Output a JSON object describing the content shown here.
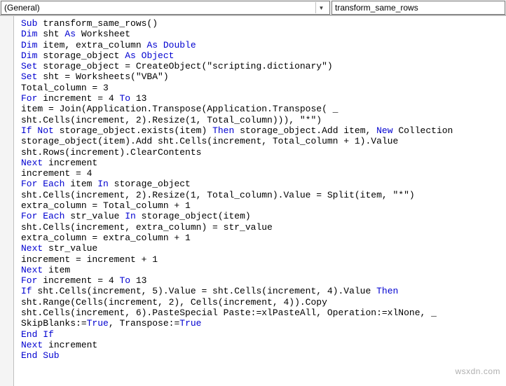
{
  "topbar": {
    "left_dropdown": "(General)",
    "right_dropdown": "transform_same_rows"
  },
  "code_tokens": [
    [
      [
        "kw",
        "Sub"
      ],
      [
        "",
        " transform_same_rows()"
      ]
    ],
    [
      [
        "kw",
        "Dim"
      ],
      [
        "",
        " sht "
      ],
      [
        "kw",
        "As"
      ],
      [
        "",
        " Worksheet"
      ]
    ],
    [
      [
        "kw",
        "Dim"
      ],
      [
        "",
        " item, extra_column "
      ],
      [
        "kw",
        "As Double"
      ]
    ],
    [
      [
        "kw",
        "Dim"
      ],
      [
        "",
        " storage_object "
      ],
      [
        "kw",
        "As Object"
      ]
    ],
    [
      [
        "kw",
        "Set"
      ],
      [
        "",
        " storage_object = CreateObject(\"scripting.dictionary\")"
      ]
    ],
    [
      [
        "kw",
        "Set"
      ],
      [
        "",
        " sht = Worksheets(\"VBA\")"
      ]
    ],
    [
      [
        "",
        "Total_column = 3"
      ]
    ],
    [
      [
        "kw",
        "For"
      ],
      [
        "",
        " increment = 4 "
      ],
      [
        "kw",
        "To"
      ],
      [
        "",
        " 13"
      ]
    ],
    [
      [
        "",
        "item = Join(Application.Transpose(Application.Transpose( _"
      ]
    ],
    [
      [
        "",
        "sht.Cells(increment, 2).Resize(1, Total_column))), \"*\")"
      ]
    ],
    [
      [
        "kw",
        "If Not"
      ],
      [
        "",
        " storage_object.exists(item) "
      ],
      [
        "kw",
        "Then"
      ],
      [
        "",
        " storage_object.Add item, "
      ],
      [
        "kw",
        "New"
      ],
      [
        "",
        " Collection"
      ]
    ],
    [
      [
        "",
        "storage_object(item).Add sht.Cells(increment, Total_column + 1).Value"
      ]
    ],
    [
      [
        "",
        "sht.Rows(increment).ClearContents"
      ]
    ],
    [
      [
        "kw",
        "Next"
      ],
      [
        "",
        " increment"
      ]
    ],
    [
      [
        "",
        "increment = 4"
      ]
    ],
    [
      [
        "kw",
        "For Each"
      ],
      [
        "",
        " item "
      ],
      [
        "kw",
        "In"
      ],
      [
        "",
        " storage_object"
      ]
    ],
    [
      [
        "",
        "sht.Cells(increment, 2).Resize(1, Total_column).Value = Split(item, \"*\")"
      ]
    ],
    [
      [
        "",
        "extra_column = Total_column + 1"
      ]
    ],
    [
      [
        "kw",
        "For Each"
      ],
      [
        "",
        " str_value "
      ],
      [
        "kw",
        "In"
      ],
      [
        "",
        " storage_object(item)"
      ]
    ],
    [
      [
        "",
        "sht.Cells(increment, extra_column) = str_value"
      ]
    ],
    [
      [
        "",
        "extra_column = extra_column + 1"
      ]
    ],
    [
      [
        "kw",
        "Next"
      ],
      [
        "",
        " str_value"
      ]
    ],
    [
      [
        "",
        "increment = increment + 1"
      ]
    ],
    [
      [
        "kw",
        "Next"
      ],
      [
        "",
        " item"
      ]
    ],
    [
      [
        "kw",
        "For"
      ],
      [
        "",
        " increment = 4 "
      ],
      [
        "kw",
        "To"
      ],
      [
        "",
        " 13"
      ]
    ],
    [
      [
        "kw",
        "If"
      ],
      [
        "",
        " sht.Cells(increment, 5).Value = sht.Cells(increment, 4).Value "
      ],
      [
        "kw",
        "Then"
      ]
    ],
    [
      [
        "",
        "sht.Range(Cells(increment, 2), Cells(increment, 4)).Copy"
      ]
    ],
    [
      [
        "",
        "sht.Cells(increment, 6).PasteSpecial Paste:=xlPasteAll, Operation:=xlNone, _"
      ]
    ],
    [
      [
        "",
        "SkipBlanks:="
      ],
      [
        "kw",
        "True"
      ],
      [
        "",
        ", Transpose:="
      ],
      [
        "kw",
        "True"
      ]
    ],
    [
      [
        "kw",
        "End If"
      ]
    ],
    [
      [
        "kw",
        "Next"
      ],
      [
        "",
        " increment"
      ]
    ],
    [
      [
        "kw",
        "End Sub"
      ]
    ]
  ],
  "watermark": "wsxdn.com"
}
